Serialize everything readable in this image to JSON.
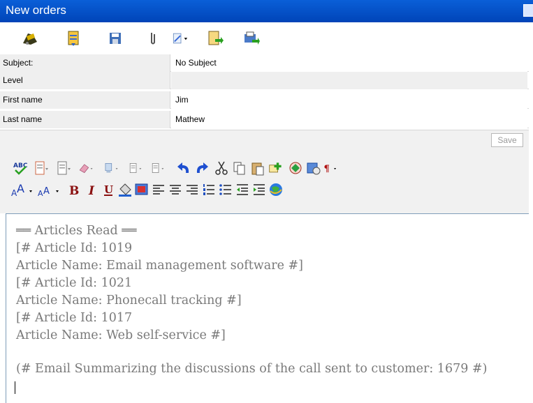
{
  "window": {
    "title": "New orders"
  },
  "toolbar": {
    "icons": [
      "send-icon",
      "notes-icon",
      "save-icon",
      "attach-icon",
      "edit-dropdown-icon",
      "document-export-icon",
      "print-icon"
    ]
  },
  "fields": [
    {
      "label": "Subject:",
      "value": "No Subject"
    },
    {
      "label": "Level",
      "value": ""
    },
    {
      "label": "First name",
      "value": "Jim"
    },
    {
      "label": "Last name",
      "value": "Mathew"
    }
  ],
  "save_label": "Save",
  "editor": {
    "lines": [
      "══ Articles Read ══",
      "[# Article Id: 1019",
      "Article Name: Email management software #]",
      "[# Article Id: 1021",
      "Article Name: Phonecall tracking #]",
      "[# Article Id: 1017",
      "Article Name: Web self-service #]",
      "",
      "(# Email Summarizing the discussions of the call sent to customer: 1679 #)"
    ]
  },
  "colors": {
    "titlebar": "#0a5fd8",
    "panel": "#f1f1f1",
    "label_bg": "#efefef",
    "text_gray": "#7a7a7a"
  }
}
